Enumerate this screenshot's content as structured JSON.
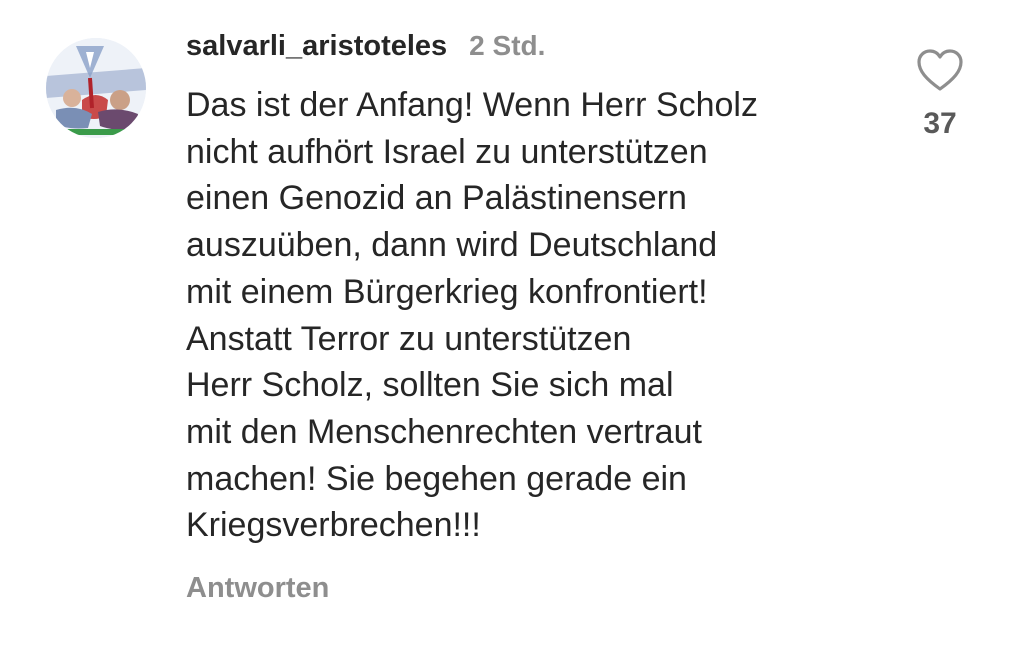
{
  "comment": {
    "username": "salvarli_aristoteles",
    "time": "2 Std.",
    "lines": [
      "Das ist der Anfang! Wenn Herr Scholz",
      "nicht aufhört Israel zu unterstützen",
      "einen Genozid an Palästinensern",
      "auszuüben, dann wird Deutschland",
      "mit einem Bürgerkrieg konfrontiert!",
      "Anstatt Terror zu unterstützen",
      "Herr Scholz, sollten Sie sich mal",
      "mit den Menschenrechten vertraut",
      "machen! Sie begehen gerade ein",
      "Kriegsverbrechen!!!"
    ],
    "reply_label": "Antworten",
    "like_count": "37"
  },
  "icons": {
    "like": "heart-icon",
    "avatar": "profile-picture"
  },
  "colors": {
    "text": "#262626",
    "secondary": "#8e8e8e"
  }
}
